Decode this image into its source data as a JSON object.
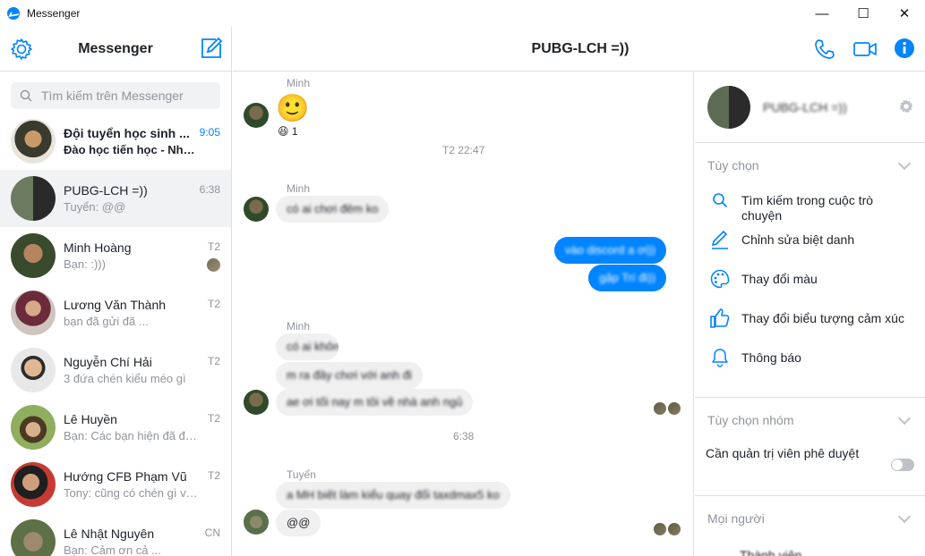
{
  "window": {
    "title": "Messenger",
    "minimize": "—",
    "maximize": "☐",
    "close": "✕"
  },
  "left": {
    "title": "Messenger",
    "search_placeholder": "Tìm kiếm trên Messenger",
    "conversations": [
      {
        "name": "Đội tuyển học sinh ...",
        "snippet": "Đào học tiến học - Nhu...",
        "time": "9:05"
      },
      {
        "name": "PUBG-LCH =))",
        "snippet": "Tuyển: @@",
        "time": "6:38"
      },
      {
        "name": "Minh Hoàng",
        "snippet": "Bạn: :)))",
        "time": "T2"
      },
      {
        "name": "Lương Văn Thành",
        "snippet": "bạn đã gửi đã ...",
        "time": "T2"
      },
      {
        "name": "Nguyễn Chí Hải",
        "snippet": "3 đứa chén kiểu méo gì",
        "time": "T2"
      },
      {
        "name": "Lê Huyền",
        "snippet": "Bạn: Các bạn hiện đã đư...",
        "time": "T2"
      },
      {
        "name": "Hướng CFB Phạm Vũ",
        "snippet": "Tony: cũng có chén gì về ...",
        "time": "T2"
      },
      {
        "name": "Lê Nhật Nguyên",
        "snippet": "Bạn: Cảm ơn cả ...",
        "time": "CN"
      }
    ]
  },
  "chat": {
    "title": "PUBG-LCH =))",
    "reaction_count": "1",
    "emoji_glyph": "🙂",
    "reaction_glyph": "😆",
    "stamps": [
      "T2 22:47",
      "6:38"
    ],
    "senders": [
      "Minh",
      "Minh",
      "Minh",
      "Tuyển"
    ],
    "messages": [
      "có ai chơi đêm ko",
      "vào discord a ơi))",
      "gặp Trí đi))",
      "có ai không",
      "m ra đây chơi với anh đi",
      "ae ơi tối nay m tôi về nhà anh ngủ",
      "a MH biết làm kiểu quay đổi taxdmax5 ko",
      "@@"
    ]
  },
  "right": {
    "group_name": "PUBG-LCH =))",
    "sections": {
      "options": "Tùy chọn",
      "group_options": "Tùy chọn nhóm",
      "people": "Mọi người"
    },
    "options": [
      {
        "label": "Tìm kiếm trong cuộc trò chuyện",
        "icon": "search-icon"
      },
      {
        "label": "Chỉnh sửa biệt danh",
        "icon": "pencil-icon"
      },
      {
        "label": "Thay đổi màu",
        "icon": "palette-icon"
      },
      {
        "label": "Thay đổi biểu tượng cảm xúc",
        "icon": "thumbs-up-icon"
      },
      {
        "label": "Thông báo",
        "icon": "bell-icon"
      }
    ],
    "admin_approval": "Cần quản trị viên phê duyệt",
    "people_first": "Thành viên"
  },
  "colors": {
    "accent": "#0084ff",
    "bubble_in": "#f1f0f0",
    "muted": "#90949c"
  }
}
